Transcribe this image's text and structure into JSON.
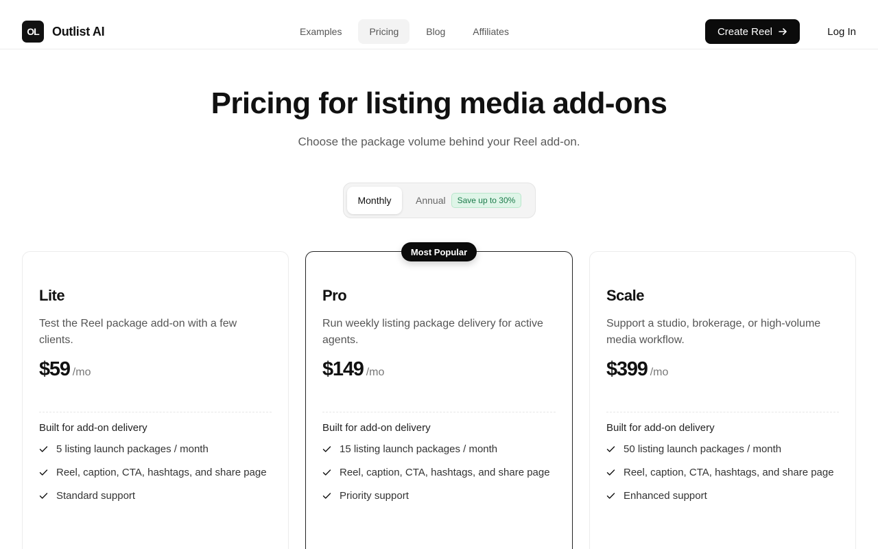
{
  "header": {
    "logo_mark": "OL",
    "brand": "Outlist AI",
    "nav": [
      {
        "label": "Examples",
        "active": false
      },
      {
        "label": "Pricing",
        "active": true
      },
      {
        "label": "Blog",
        "active": false
      },
      {
        "label": "Affiliates",
        "active": false
      }
    ],
    "cta_label": "Create Reel",
    "login_label": "Log In"
  },
  "hero": {
    "title": "Pricing for listing media add-ons",
    "subtitle": "Choose the package volume behind your Reel add-on."
  },
  "billing_toggle": {
    "selected": "Monthly",
    "monthly_label": "Monthly",
    "annual_label": "Annual",
    "annual_badge": "Save up to 30%"
  },
  "popular_badge": "Most Popular",
  "plans": [
    {
      "name": "Lite",
      "description": "Test the Reel package add-on with a few clients.",
      "price": "$59",
      "period": "/mo",
      "section_label": "Built for add-on delivery",
      "features": [
        "5 listing launch packages / month",
        "Reel, caption, CTA, hashtags, and share page",
        "Standard support"
      ]
    },
    {
      "name": "Pro",
      "description": "Run weekly listing package delivery for active agents.",
      "price": "$149",
      "period": "/mo",
      "section_label": "Built for add-on delivery",
      "features": [
        "15 listing launch packages / month",
        "Reel, caption, CTA, hashtags, and share page",
        "Priority support"
      ]
    },
    {
      "name": "Scale",
      "description": "Support a studio, brokerage, or high-volume media workflow.",
      "price": "$399",
      "period": "/mo",
      "section_label": "Built for add-on delivery",
      "features": [
        "50 listing launch packages / month",
        "Reel, caption, CTA, hashtags, and share page",
        "Enhanced support"
      ]
    }
  ],
  "colors": {
    "primary": "#0b0b0b",
    "badge_green_text": "#1b7a4a",
    "badge_green_bg": "#dff5e8"
  },
  "icons": {
    "cta": "arrow-right-icon",
    "feature": "check-icon"
  }
}
